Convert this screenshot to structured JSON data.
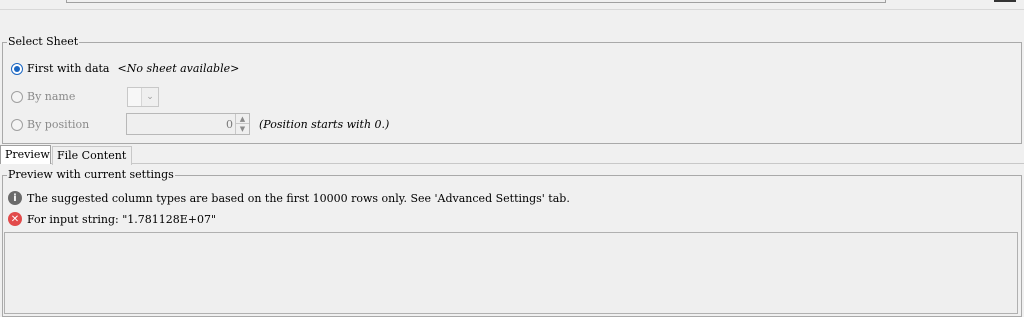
{
  "select_sheet": {
    "title": "Select Sheet",
    "options": [
      {
        "label": "First with data",
        "value": "<No sheet available>",
        "checked": true,
        "enabled": true
      },
      {
        "label": "By name",
        "checked": false,
        "enabled": false
      },
      {
        "label": "By position",
        "checked": false,
        "enabled": false
      }
    ],
    "position_value": "0",
    "position_hint": "(Position starts with 0.)"
  },
  "tabs": [
    {
      "label": "Preview",
      "active": true
    },
    {
      "label": "File Content",
      "active": false
    }
  ],
  "preview": {
    "title": "Preview with current settings",
    "messages": [
      {
        "type": "info",
        "icon": "info-icon",
        "text": "The suggested column types are based on the first 10000 rows only. See 'Advanced Settings' tab."
      },
      {
        "type": "error",
        "icon": "error-icon",
        "text": "For input string: \"1.781128E+07\""
      }
    ]
  },
  "colors": {
    "accent": "#1a66c2",
    "error": "#e24a4a",
    "info": "#6a6a6a",
    "background": "#f0f0f0"
  }
}
